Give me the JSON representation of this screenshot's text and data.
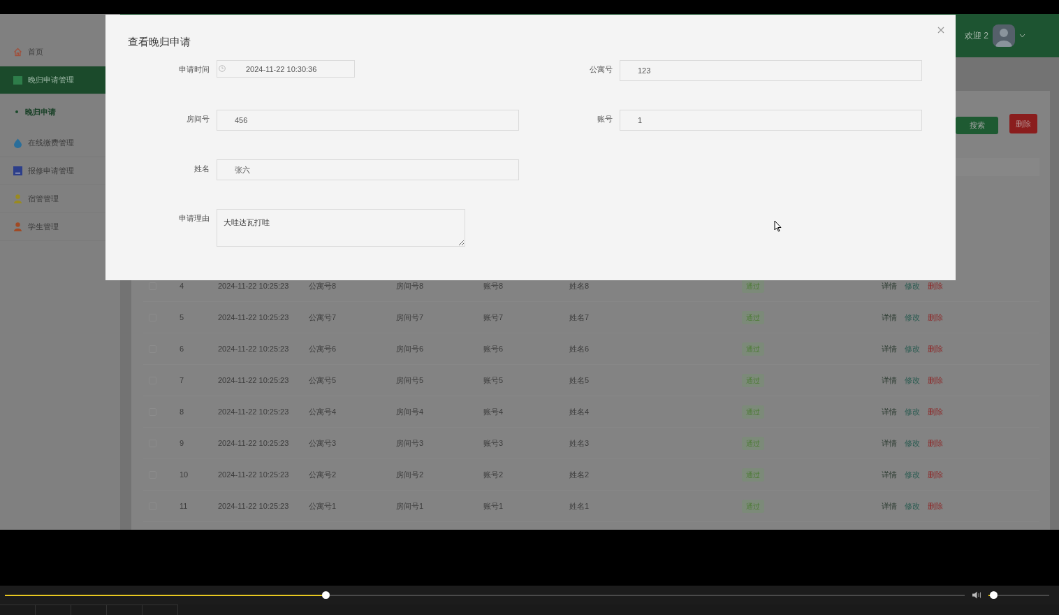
{
  "sidebar": {
    "items": [
      {
        "label": "首页",
        "kind": "home",
        "selected": false
      },
      {
        "label": "晚归申请管理",
        "kind": "grid",
        "selected": true,
        "children": [
          {
            "label": "晚归申请",
            "selected": true
          }
        ]
      },
      {
        "label": "在线缴费管理",
        "kind": "drop",
        "selected": false
      },
      {
        "label": "报修申请管理",
        "kind": "tray",
        "selected": false
      },
      {
        "label": "宿管管理",
        "kind": "person-yellow",
        "selected": false
      },
      {
        "label": "学生管理",
        "kind": "person-orange",
        "selected": false
      }
    ]
  },
  "header": {
    "greeting": "欢迎 2"
  },
  "toolbar": {
    "buttons": [
      {
        "label": "搜索",
        "kind": "primary"
      },
      {
        "label": "删除",
        "kind": "danger"
      }
    ]
  },
  "table": {
    "rows": [
      {
        "checked": false,
        "index": "4",
        "time": "2024-11-22 10:25:23",
        "apartment": "公寓号8",
        "room": "房间号8",
        "account": "账号8",
        "name": "姓名8",
        "status": "通过",
        "actions": [
          "详情",
          "修改",
          "删除"
        ]
      },
      {
        "checked": false,
        "index": "5",
        "time": "2024-11-22 10:25:23",
        "apartment": "公寓号7",
        "room": "房间号7",
        "account": "账号7",
        "name": "姓名7",
        "status": "通过",
        "actions": [
          "详情",
          "修改",
          "删除"
        ]
      },
      {
        "checked": false,
        "index": "6",
        "time": "2024-11-22 10:25:23",
        "apartment": "公寓号6",
        "room": "房间号6",
        "account": "账号6",
        "name": "姓名6",
        "status": "通过",
        "actions": [
          "详情",
          "修改",
          "删除"
        ]
      },
      {
        "checked": false,
        "index": "7",
        "time": "2024-11-22 10:25:23",
        "apartment": "公寓号5",
        "room": "房间号5",
        "account": "账号5",
        "name": "姓名5",
        "status": "通过",
        "actions": [
          "详情",
          "修改",
          "删除"
        ]
      },
      {
        "checked": false,
        "index": "8",
        "time": "2024-11-22 10:25:23",
        "apartment": "公寓号4",
        "room": "房间号4",
        "account": "账号4",
        "name": "姓名4",
        "status": "通过",
        "actions": [
          "详情",
          "修改",
          "删除"
        ]
      },
      {
        "checked": false,
        "index": "9",
        "time": "2024-11-22 10:25:23",
        "apartment": "公寓号3",
        "room": "房间号3",
        "account": "账号3",
        "name": "姓名3",
        "status": "通过",
        "actions": [
          "详情",
          "修改",
          "删除"
        ]
      },
      {
        "checked": false,
        "index": "10",
        "time": "2024-11-22 10:25:23",
        "apartment": "公寓号2",
        "room": "房间号2",
        "account": "账号2",
        "name": "姓名2",
        "status": "通过",
        "actions": [
          "详情",
          "修改",
          "删除"
        ]
      },
      {
        "checked": false,
        "index": "11",
        "time": "2024-11-22 10:25:23",
        "apartment": "公寓号1",
        "room": "房间号1",
        "account": "账号1",
        "name": "姓名1",
        "status": "通过",
        "actions": [
          "详情",
          "修改",
          "删除"
        ]
      }
    ]
  },
  "modal": {
    "title": "查看晚归申请",
    "fields": [
      {
        "label": "申请时间",
        "value": "2024-11-22 10:30:36",
        "kind": "date"
      },
      {
        "label": "公寓号",
        "value": "123",
        "kind": "text"
      },
      {
        "label": "房间号",
        "value": "456",
        "kind": "text"
      },
      {
        "label": "账号",
        "value": "1",
        "kind": "text"
      },
      {
        "label": "姓名",
        "value": "张六",
        "kind": "text"
      },
      {
        "label": "申请理由",
        "value": "大哇达瓦打哇",
        "kind": "textarea"
      }
    ]
  },
  "player": {
    "progress": {
      "level": 0.334
    },
    "volume": {
      "level": 0.08
    }
  }
}
